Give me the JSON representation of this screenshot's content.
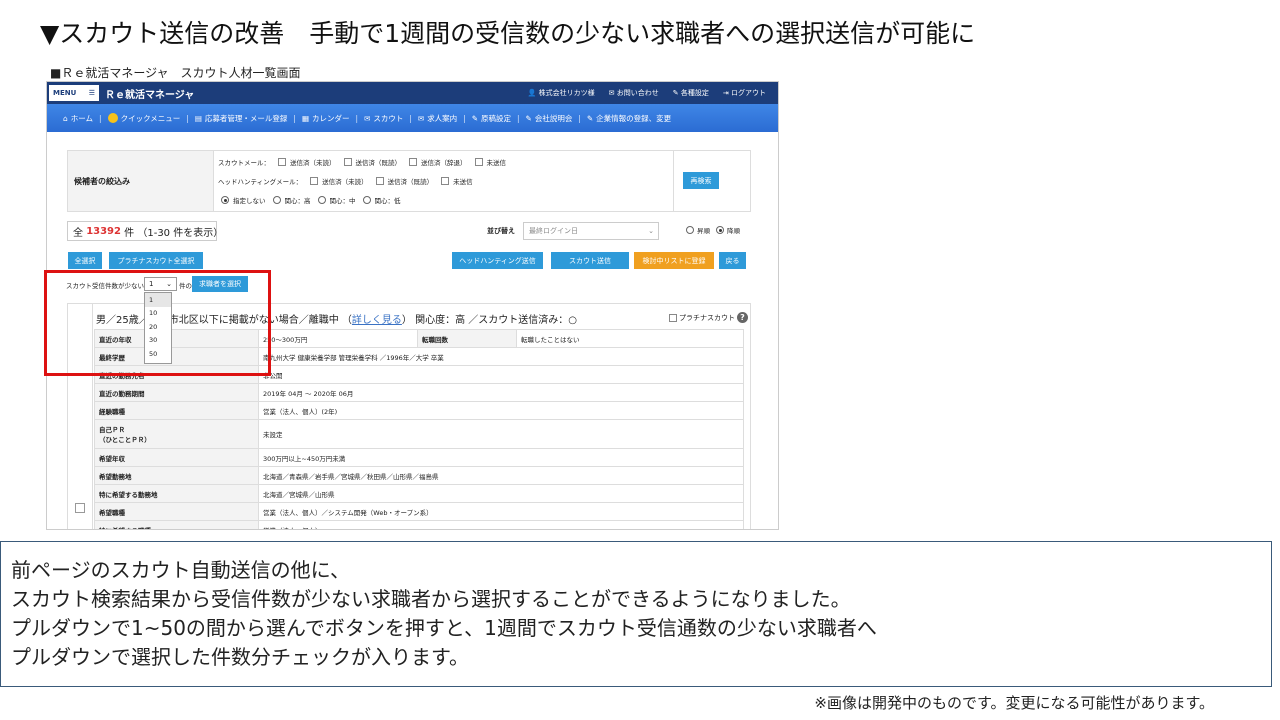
{
  "slide": {
    "title": "▼スカウト送信の改善　手動で1週間の受信数の少ない求職者への選択送信が可能に",
    "screen_caption": "■Ｒｅ就活マネージャ　スカウト人材一覧画面",
    "notes": [
      "前ページのスカウト自動送信の他に、",
      "スカウト検索結果から受信件数が少ない求職者から選択することができるようになりました。",
      "プルダウンで1~50の間から選んでボタンを押すと、1週間でスカウト受信通数の少ない求職者へ",
      "プルダウンで選択した件数分チェックが入ります。"
    ],
    "footer": "※画像は開発中のものです。変更になる可能性があります。"
  },
  "app": {
    "menu_label": "MENU",
    "brand": "Ｒｅ就活マネージャ",
    "top_links": [
      "株式会社リカツ様",
      "お問い合わせ",
      "各種設定",
      "ログアウト"
    ],
    "nav": [
      "ホーム",
      "クイックメニュー",
      "応募者管理・メール登録",
      "カレンダー",
      "スカウト",
      "求人案内",
      "原稿設定",
      "会社説明会",
      "企業情報の登録、変更"
    ],
    "filter": {
      "label": "候補者の絞込み",
      "scout_mail_label": "スカウトメール：",
      "scout_mail_options": [
        "送信済（未読）",
        "送信済（既読）",
        "送信済（辞退）",
        "未送信"
      ],
      "headhunt_label": "ヘッドハンティングメール：",
      "headhunt_options": [
        "送信済（未読）",
        "送信済（既読）",
        "未送信"
      ],
      "interest_options": [
        "指定しない",
        "関心：高",
        "関心：中",
        "関心：低"
      ],
      "search_button": "再検索"
    },
    "total": {
      "prefix": "全",
      "count": "13392",
      "suffix": "件 （1-30 件を表示）"
    },
    "sort": {
      "label": "並び替え",
      "value": "最終ログイン日",
      "asc": "昇順",
      "desc": "降順"
    },
    "buttons": {
      "select_all": "全選択",
      "platinum_select_all": "プラチナスカウト全選択",
      "headhunt_send": "ヘッドハンティング送信",
      "scout_send": "スカウト送信",
      "add_to_list": "検討中リストに登録",
      "back": "戻る"
    },
    "receive_select": {
      "label": "スカウト受信件数が少ない",
      "value": "1",
      "unit": "件の",
      "button": "求職者を選択",
      "options": [
        "1",
        "10",
        "20",
        "30",
        "50"
      ]
    },
    "candidate": {
      "title_prefix": "男／25歳／",
      "title_location": "大阪市北区以下に掲載がない場合／離職中",
      "details_link": "詳しく見る",
      "title_suffix": "関心度：高 ／スカウト送信済み：○",
      "platinum_label": "プラチナスカウト",
      "help": "?",
      "rows": [
        {
          "k": "直近の年収",
          "v": "250～300万円",
          "k2": "転職回数",
          "v2": "転職したことはない"
        },
        {
          "k": "最終学歴",
          "v": "南九州大学 健康栄養学部 管理栄養学科 ／1996年／大学 卒業"
        },
        {
          "k": "直近の勤務先名",
          "v": "非公開"
        },
        {
          "k": "直近の勤務期間",
          "v": "2019年 04月 ～ 2020年 06月"
        },
        {
          "k": "経験職種",
          "v": "営業（法人、個人）(2年)"
        },
        {
          "k": "自己ＰＲ\n（ひとことＰＲ）",
          "v": "未設定"
        },
        {
          "k": "希望年収",
          "v": "300万円以上~450万円未満"
        },
        {
          "k": "希望勤務地",
          "v": "北海道／青森県／岩手県／宮城県／秋田県／山形県／福島県"
        },
        {
          "k": "特に希望する勤務地",
          "v": "北海道／宮城県／山形県"
        },
        {
          "k": "希望職種",
          "v": "営業（法人、個人）／システム開発（Web・オープン系）"
        },
        {
          "k": "特に希望する職種",
          "v": "営業（法人、個人）"
        }
      ]
    }
  }
}
